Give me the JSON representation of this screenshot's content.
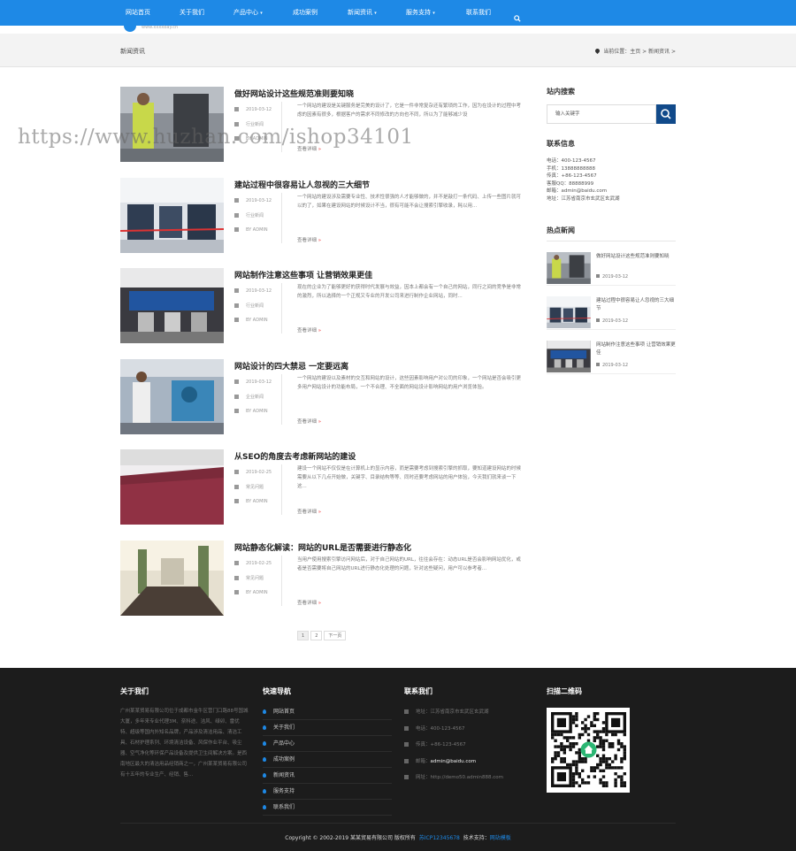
{
  "nav": {
    "items": [
      {
        "label": "网站首页",
        "caret": false
      },
      {
        "label": "关于我们",
        "caret": false
      },
      {
        "label": "产品中心",
        "caret": true
      },
      {
        "label": "成功案例",
        "caret": false
      },
      {
        "label": "新闻资讯",
        "caret": true
      },
      {
        "label": "服务支持",
        "caret": true
      },
      {
        "label": "联系我们",
        "caret": false
      }
    ],
    "logo_fragment": "www.xxxxbay.cn",
    "color": "#1e89e6"
  },
  "crumb": {
    "title": "新闻资讯",
    "location": "当前位置：主页 > 新闻资讯 >"
  },
  "posts": [
    {
      "title": "做好网站设计这些规范准则要知晓",
      "date": "2019-03-12",
      "category": "行业新闻",
      "author": "BY ADMIN",
      "excerpt": "一个网站的建设是关键服务是完美的设计了，它是一件非常复杂还有繁琐的工作，因为在设计的过程中考虑的因素有很多，根据客户的需求不同修改的方向也不同，所以为了能够减少设",
      "more": "查看详细"
    },
    {
      "title": "建站过程中很容易让人忽视的三大细节",
      "date": "2019-03-12",
      "category": "行业新闻",
      "author": "BY ADMIN",
      "excerpt": "一个网站的建设涉及需要专业性、技术性很强的人才能够做的，并不是敲打一条代码、上传一些图片就可以的了，如果在建设网站的时候设计不当，很有可能不会让搜索引擎收录，耗以用...",
      "more": "查看详细"
    },
    {
      "title": "网站制作注意这些事项 让营销效果更佳",
      "date": "2019-03-12",
      "category": "行业新闻",
      "author": "BY ADMIN",
      "excerpt": "现在的企业为了能够更好的获得时代发展与效益，因本上都会有一个自己的网站，同行之间的竞争是非常的激烈，所以选择的一个正规又专业的开发公司来进行制作企业网站，同时...",
      "more": "查看详细"
    },
    {
      "title": "网站设计的四大禁忌 一定要远离",
      "date": "2019-03-12",
      "category": "企业新闻",
      "author": "BY ADMIN",
      "excerpt": "一个网站的建设以及素材的交互和网站的设计，这些因素影响用户对公司的印象，一个网站是否会吸引更多用户网站设计的功能布局，一个不合理、不全面的网站设计影响网站的用户浏览体验。",
      "more": "查看详细"
    },
    {
      "title": "从SEO的角度去考虑新网站的建设",
      "date": "2019-02-25",
      "category": "常见问题",
      "author": "BY ADMIN",
      "excerpt": "建设一个网站不仅仅是在计算机上的显示内容，而是需要考虑到搜索引擎的抓取，要知道建设网站的时候需要从以下几点开始做，关键字、目录结构等等、同时还要考虑网站的用户体验，今天我们就来谈一下这...",
      "more": "查看详细"
    },
    {
      "title": "网站静态化解读：网站的URL是否需要进行静态化",
      "date": "2019-02-25",
      "category": "常见问题",
      "author": "BY ADMIN",
      "excerpt": "当用户使用搜索引擎访问网站后，对于自己网站的URL，往往会存在：动态URL是否会影响网站优化，或者是否需要将自己网站的URL进行静态化处理的问题，针对这些疑问，用户可以参考者...",
      "more": "查看详细"
    }
  ],
  "pager": [
    "1",
    "2",
    "下一页"
  ],
  "sidebar": {
    "search_title": "站内搜索",
    "search_placeholder": "输入关键字",
    "contact_title": "联系信息",
    "contact_lines": [
      "电话：400-123-4567",
      "手机：13888888888",
      "传真：+86-123-4567",
      "客服QQ：88888999",
      "邮箱：admin@baidu.com",
      "地址：江苏省南京市玄武区玄武湖"
    ],
    "hot_title": "热点新闻",
    "hot": [
      {
        "title": "做好网站设计这些规范准则要知晓",
        "date": "2019-03-12"
      },
      {
        "title": "建站过程中很容易让人忽视的三大细节",
        "date": "2019-03-12"
      },
      {
        "title": "网站制作注意这些事项 让营销效果更佳",
        "date": "2019-03-12"
      }
    ]
  },
  "footer": {
    "about_title": "关于我们",
    "about_text": "广州某某贸易有限公司位于成都市金牛区营门口路88号国城大厦，多年来专业代理3M、奈科途、洁风、绿卯、雷优特、超级等国内外知名品牌，产品涉及清洁用品、清洁工具、石材护理系列、环境清洁设备、风保作业平台、吸尘器、空气净化等环保产品设备及提供卫生间解决方案。是西南地区最大的清洁用品经销商之一，广州某某贸易有限公司有十五年的专业生产、经销、售...",
    "quick_title": "快速导航",
    "quick_links": [
      "网站首页",
      "关于我们",
      "产品中心",
      "成功案例",
      "新闻资讯",
      "服务支持",
      "联系我们"
    ],
    "contact_title": "联系我们",
    "contact": [
      {
        "label": "地址：",
        "value": "江苏省南京市玄武区玄武湖",
        "hl": false
      },
      {
        "label": "电话：",
        "value": "400-123-4567",
        "hl": false
      },
      {
        "label": "传真：",
        "value": "+86-123-4567",
        "hl": false
      },
      {
        "label": "邮箱：",
        "value": "admin@baidu.com",
        "hl": true
      },
      {
        "label": "网址：",
        "value": "http://demo50.admin888.com",
        "hl": false
      }
    ],
    "qr_title": "扫描二维码",
    "copyright": "Copyright © 2002-2019 某某贸易有限公司 版权所有",
    "icp": "苏ICP12345678",
    "tech_label": "技术支持：",
    "tech_value": "网站模板"
  },
  "watermark": "https://www.huzhan.com/ishop34101",
  "colors": {
    "accent": "#1e89e6",
    "footer_bg": "#1c1c1c",
    "search_btn": "#114a8a",
    "more_arrow": "#ee3333"
  }
}
